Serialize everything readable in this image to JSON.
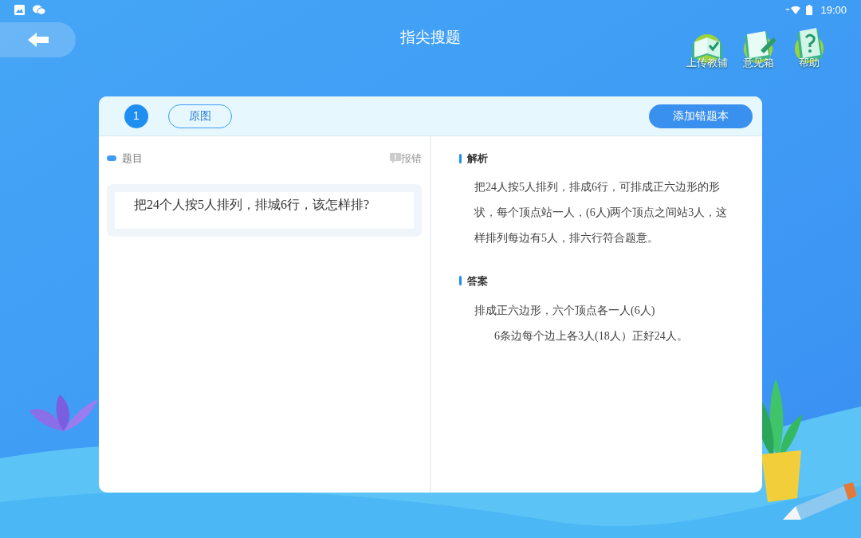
{
  "status_bar": {
    "time": "19:00"
  },
  "header": {
    "title": "指尖搜题",
    "tools": [
      {
        "label": "上传教辅",
        "kind": "book"
      },
      {
        "label": "意见箱",
        "kind": "notepad"
      },
      {
        "label": "帮助",
        "kind": "help"
      }
    ]
  },
  "card": {
    "question_number": "1",
    "original_image_button": "原图",
    "add_button": "添加错题本",
    "question_label": "题目",
    "report_button": "报错",
    "question_text": "把24个人按5人排列，排城6行，该怎样排?",
    "analysis": {
      "title": "解析",
      "text": "把24人按5人排列，排成6行，可排成正六边形的形状，每个顶点站一人，(6人)两个顶点之间站3人，这样排列每边有5人，排六行符合题意。"
    },
    "answer": {
      "title": "答案",
      "lines": [
        {
          "text": "排成正六边形，六个顶点各一人(6人)",
          "indented": false
        },
        {
          "text": "6条边每个边上各3人(18人）正好24人。",
          "indented": true
        }
      ]
    }
  }
}
